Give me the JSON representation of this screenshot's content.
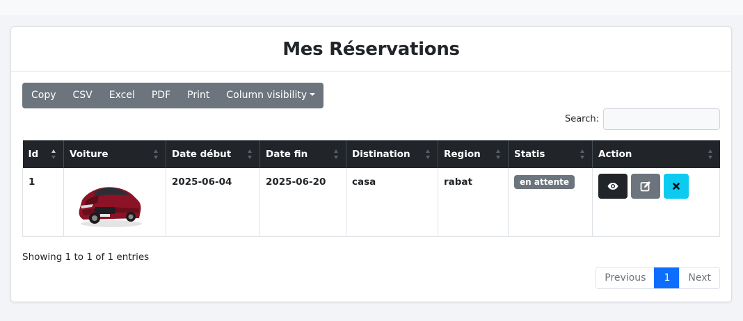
{
  "page": {
    "title": "Mes Réservations"
  },
  "toolbar": {
    "buttons": [
      "Copy",
      "CSV",
      "Excel",
      "PDF",
      "Print",
      "Column visibility"
    ]
  },
  "search": {
    "label": "Search:",
    "value": ""
  },
  "table": {
    "headers": [
      "Id",
      "Voiture",
      "Date début",
      "Date fin",
      "Distination",
      "Region",
      "Statis",
      "Action"
    ],
    "rows": [
      {
        "id": "1",
        "car_image": "red-car-image",
        "date_debut": "2025-06-04",
        "date_fin": "2025-06-20",
        "destination": "casa",
        "region": "rabat",
        "status": "en attente"
      }
    ]
  },
  "footer": {
    "info": "Showing 1 to 1 of 1 entries",
    "pagination": {
      "previous": "Previous",
      "current": "1",
      "next": "Next"
    }
  },
  "colors": {
    "header_bg": "#212529",
    "btn_group_bg": "#6c757d",
    "status_badge": "#6c757d",
    "view_btn": "#212529",
    "edit_btn": "#6c757d",
    "delete_btn": "#0dcaf0",
    "page_active": "#0d6efd"
  }
}
